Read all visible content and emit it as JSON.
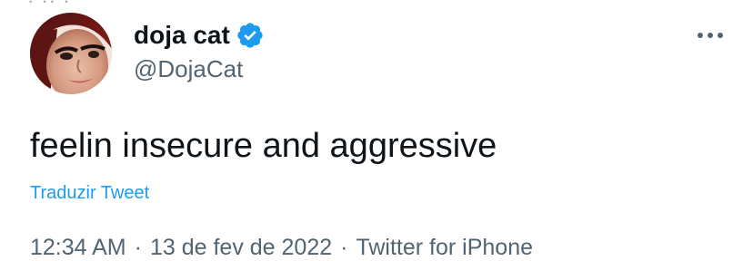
{
  "tweet": {
    "top_clip_text": "",
    "author": {
      "display_name": "doja cat",
      "handle": "@DojaCat",
      "verified": true,
      "avatar_icon": "profile-photo"
    },
    "more_icon": "more-horizontal-icon",
    "text": "feelin insecure and aggressive",
    "translate_label": "Traduzir Tweet",
    "meta": {
      "time": "12:34 AM",
      "separator": "·",
      "date": "13 de fev de 2022",
      "source": "Twitter for iPhone"
    },
    "colors": {
      "text": "#0f1419",
      "secondary": "#536471",
      "accent": "#1d9bf0"
    }
  }
}
